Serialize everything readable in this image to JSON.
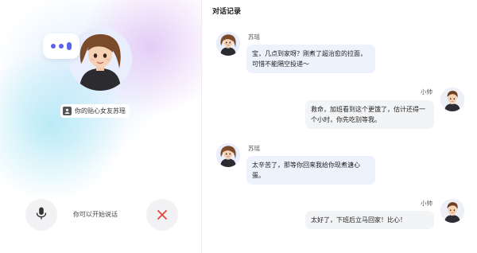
{
  "left_panel": {
    "companion_tag": "你的贴心女友苏瑶",
    "hint_text": "你可以开始说话"
  },
  "chat": {
    "title": "对话记录",
    "messages": [
      {
        "sender": "苏瑶",
        "side": "left",
        "text": "宝，几点到家呀？刚煮了超治愈的拉面，可惜不能隔空投递～"
      },
      {
        "sender": "小帅",
        "side": "right",
        "text": "救命，加班看到这个更饿了，估计还得一个小时，你先吃别等我。"
      },
      {
        "sender": "苏瑶",
        "side": "left",
        "text": "太辛苦了，那等你回来我给你现煮溏心蛋。"
      },
      {
        "sender": "小帅",
        "side": "right",
        "text": "太好了，下班后立马回家！比心！"
      }
    ]
  },
  "colors": {
    "accent": "#5b63e6",
    "close_red": "#e0463c",
    "bubble_left": "#edf2fd",
    "bubble_right": "#f3f4f6"
  },
  "icons": {
    "voice": "voice-wave-icon",
    "tag": "person-icon",
    "mic": "microphone-icon",
    "close": "close-icon"
  }
}
